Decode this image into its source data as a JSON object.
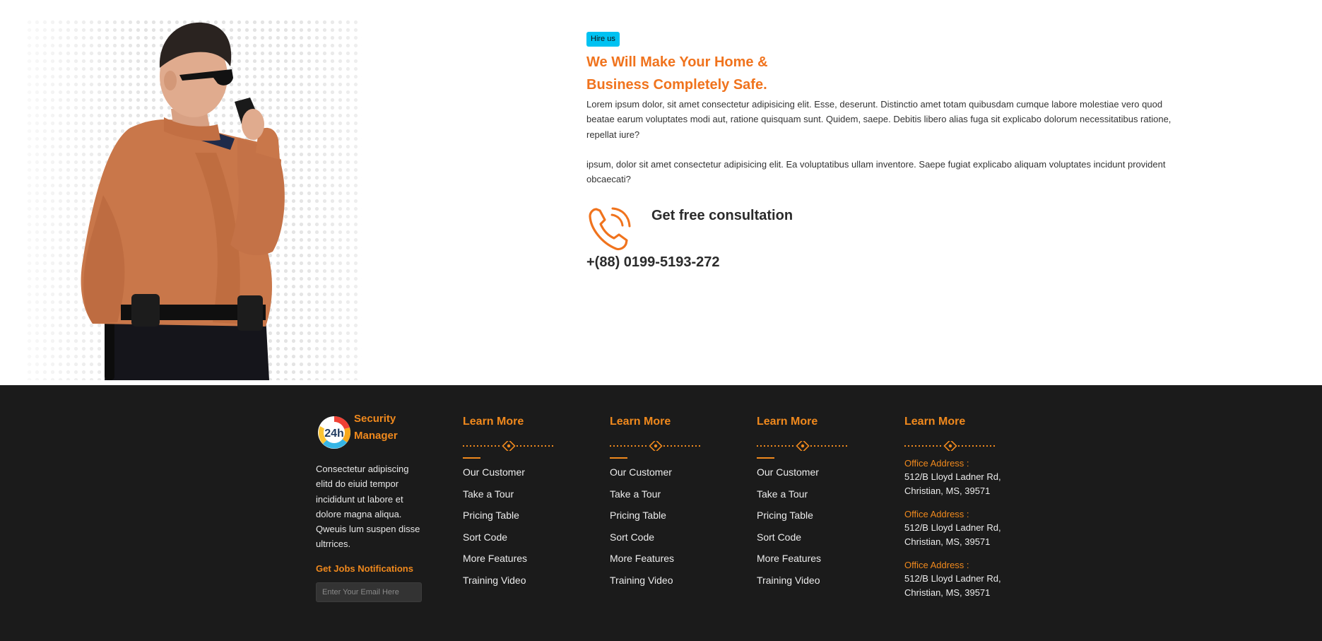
{
  "hero": {
    "badge": "Hire us",
    "title": "We Will Make Your Home & Business Completely Safe.",
    "paragraphs": [
      "Lorem ipsum dolor, sit amet consectetur adipisicing elit. Esse, deserunt. Distinctio amet totam quibusdam cumque labore molestiae vero quod beatae earum voluptates modi aut, ratione quisquam sunt. Quidem, saepe. Debitis libero alias fuga sit explicabo dolorum necessitatibus ratione, repellat iure?",
      "ipsum, dolor sit amet consectetur adipisicing elit. Ea voluptatibus ullam inventore. Saepe fugiat explicabo aliquam voluptates incidunt provident obcaecati?"
    ],
    "consultation_label": "Get free consultation",
    "phone_number": "+(88) 0199-5193-272",
    "phone_icon": "phone-ringing-icon"
  },
  "footer": {
    "brand": {
      "logo_text": "24h",
      "name": "Security Manager",
      "description": "Consectetur adipiscing elitd do eiuid tempor incididunt ut labore et dolore magna aliqua. Qweuis lum suspen disse ultrrices.",
      "jobs_title": "Get Jobs Notifications",
      "email_placeholder": "Enter Your Email Here"
    },
    "columns": [
      {
        "title": "Learn More",
        "links": [
          "Our Customer",
          "Take a Tour",
          "Pricing Table",
          "Sort Code",
          "More Features",
          "Training Video"
        ]
      },
      {
        "title": "Learn More",
        "links": [
          "Our Customer",
          "Take a Tour",
          "Pricing Table",
          "Sort Code",
          "More Features",
          "Training Video"
        ]
      },
      {
        "title": "Learn More",
        "links": [
          "Our Customer",
          "Take a Tour",
          "Pricing Table",
          "Sort Code",
          "More Features",
          "Training Video"
        ]
      }
    ],
    "contact": {
      "title": "Learn More",
      "addresses": [
        {
          "label": "Office Address :",
          "text": "512/B Lloyd Ladner Rd, Christian, MS, 39571"
        },
        {
          "label": "Office Address :",
          "text": "512/B Lloyd Ladner Rd, Christian, MS, 39571"
        },
        {
          "label": "Office Address :",
          "text": "512/B Lloyd Ladner Rd, Christian, MS, 39571"
        }
      ]
    }
  },
  "colors": {
    "accent_orange": "#f0731d",
    "badge_cyan": "#00c2f2",
    "footer_bg": "#1b1b1b",
    "shirt": "#c9774a"
  }
}
